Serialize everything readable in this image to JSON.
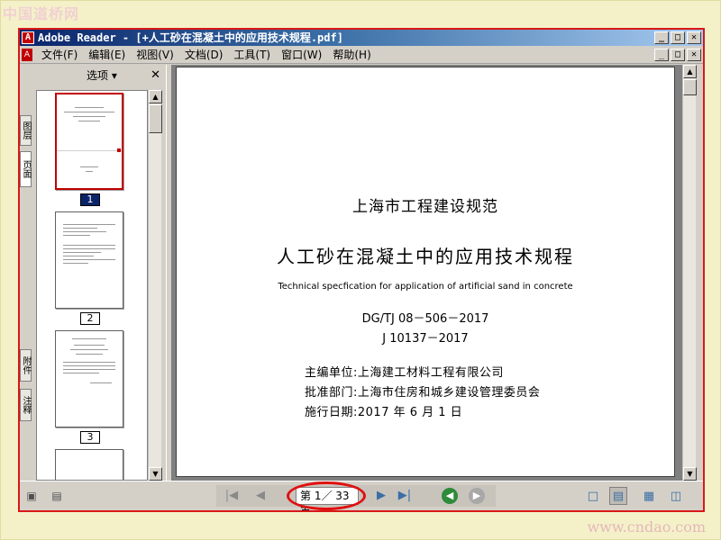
{
  "watermark": {
    "top_text": "中国道桥网",
    "bottom_text": "www.cndao.com"
  },
  "window": {
    "title": "Adobe Reader - [+人工砂在混凝土中的应用技术规程.pdf]",
    "buttons": {
      "minimize": "_",
      "restore": "□",
      "close": "✕"
    }
  },
  "menubar": {
    "items": [
      "文件(F)",
      "编辑(E)",
      "视图(V)",
      "文档(D)",
      "工具(T)",
      "窗口(W)",
      "帮助(H)"
    ]
  },
  "left_panel": {
    "side_tabs": [
      "图层",
      "页面",
      "附件",
      "注释"
    ],
    "options_label": "选项 ▾",
    "close": "✕",
    "thumbnails": [
      {
        "page": "1",
        "selected": true
      },
      {
        "page": "2",
        "selected": false
      },
      {
        "page": "3",
        "selected": false
      }
    ]
  },
  "document_page": {
    "standard_type": "上海市工程建设规范",
    "title": "人工砂在混凝土中的应用技术规程",
    "title_en": "Technical specfication for application of artificial sand in concrete",
    "code1": "DG/TJ 08－506－2017",
    "code2": "J 10137－2017",
    "editor": "主编单位:上海建工材料工程有限公司",
    "approver": "批准部门:上海市住房和城乡建设管理委员会",
    "effective_date": "施行日期:2017 年 6 月 1 日"
  },
  "statusbar": {
    "page_indicator": "第 1／ 33 页",
    "nav": {
      "first": "|◀",
      "prev": "◀",
      "next": "▶",
      "last": "▶|"
    }
  },
  "colors": {
    "annotation_red": "#e01010",
    "titlebar_start": "#0a246a",
    "titlebar_end": "#a6caf0",
    "background_yellow": "#f4f1c9"
  }
}
